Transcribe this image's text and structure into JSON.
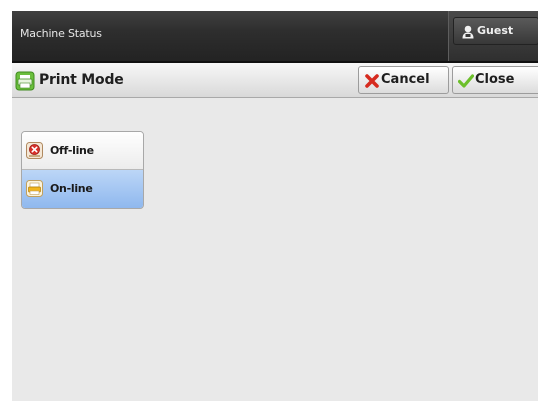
{
  "header": {
    "title": "Machine Status",
    "user_label": "Guest"
  },
  "toolbar": {
    "title": "Print Mode",
    "cancel_label": "Cancel",
    "close_label": "Close"
  },
  "options": {
    "items": [
      {
        "label": "Off-line",
        "icon": "offline-icon",
        "selected": false
      },
      {
        "label": "On-line",
        "icon": "online-icon",
        "selected": true
      }
    ]
  },
  "colors": {
    "header_bg": "#2e2e2e",
    "content_bg": "#e9e9e9",
    "selected_bg": "#a3c4f3",
    "cancel_icon": "#d62b1f",
    "close_icon": "#6cbf2a"
  }
}
